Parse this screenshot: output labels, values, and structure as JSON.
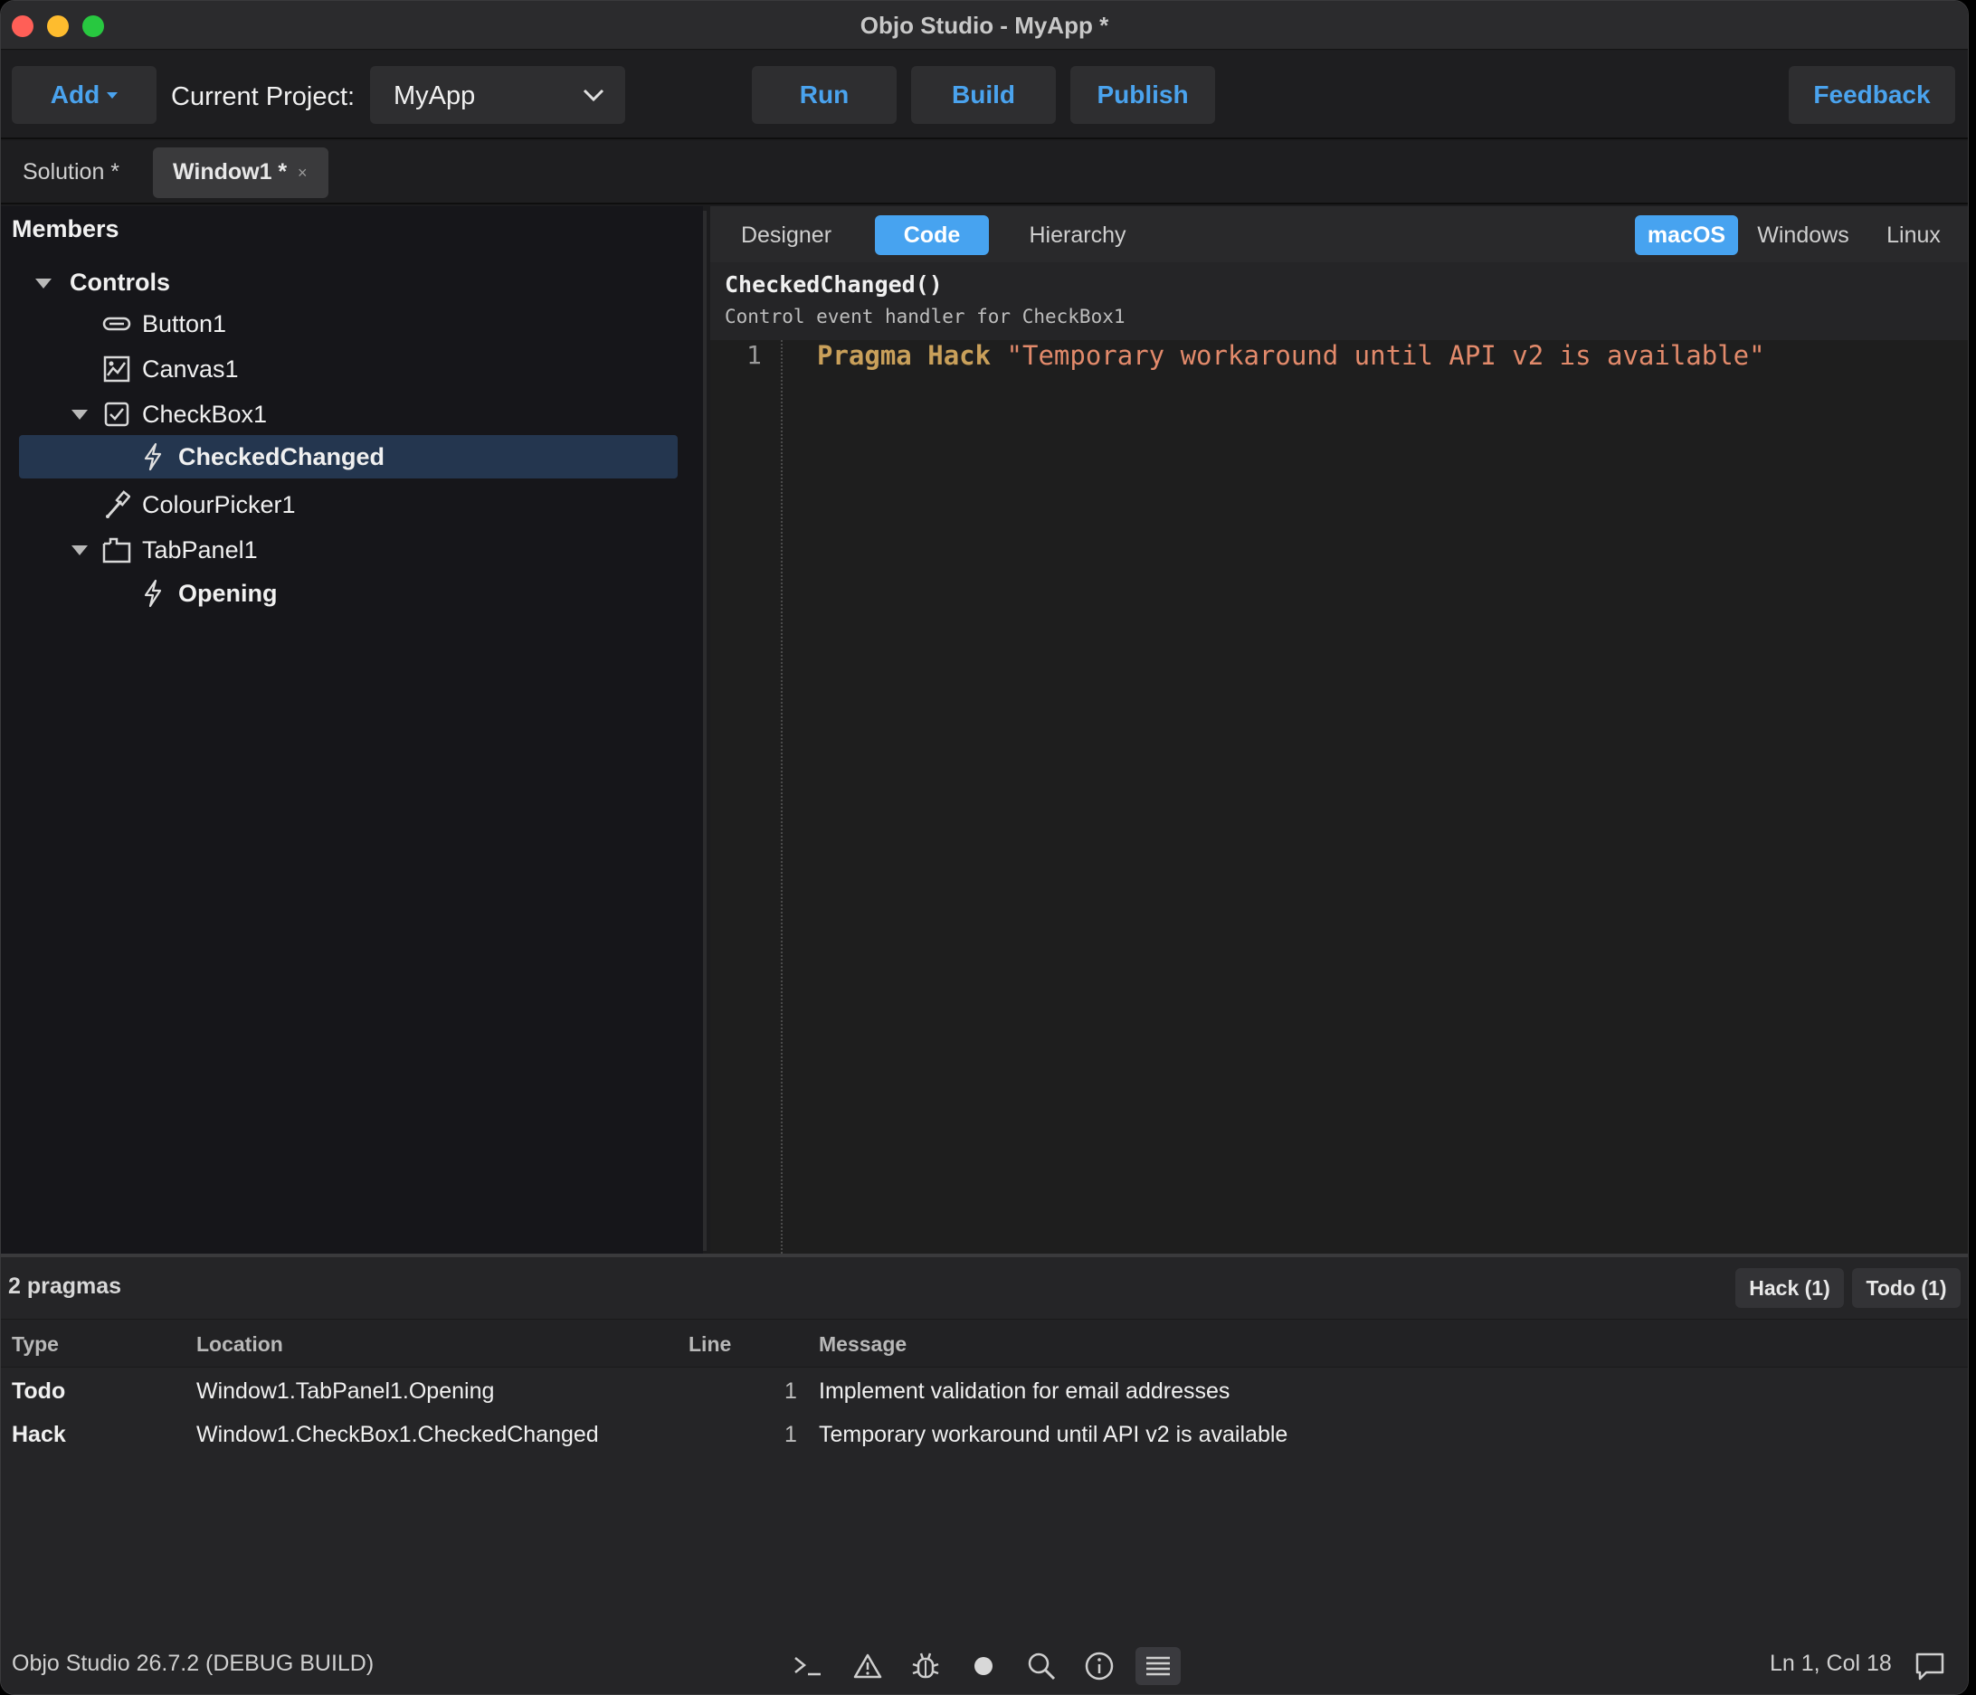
{
  "window": {
    "title": "Objo Studio - MyApp *"
  },
  "toolbar": {
    "add_label": "Add",
    "project_label": "Current Project:",
    "project_value": "MyApp",
    "run_label": "Run",
    "build_label": "Build",
    "publish_label": "Publish",
    "feedback_label": "Feedback",
    "accent_color": "#4aa3ee"
  },
  "doc_tabs": {
    "solution_label": "Solution *",
    "window1_label": "Window1 *",
    "close_glyph": "×"
  },
  "members": {
    "title": "Members",
    "controls_label": "Controls",
    "items": [
      {
        "label": "Button1",
        "icon": "button-icon"
      },
      {
        "label": "Canvas1",
        "icon": "canvas-icon"
      },
      {
        "label": "CheckBox1",
        "icon": "checkbox-icon"
      },
      {
        "label": "CheckedChanged",
        "icon": "event-bolt-icon",
        "selected": true
      },
      {
        "label": "ColourPicker1",
        "icon": "colour-picker-icon"
      },
      {
        "label": "TabPanel1",
        "icon": "tab-panel-icon"
      },
      {
        "label": "Opening",
        "icon": "event-bolt-icon"
      }
    ],
    "selected_color": "#24364f"
  },
  "view_tabs": {
    "designer": "Designer",
    "code": "Code",
    "hierarchy": "Hierarchy",
    "macos": "macOS",
    "windows": "Windows",
    "linux": "Linux",
    "active_color": "#47a3f0"
  },
  "editor": {
    "signature": "CheckedChanged()",
    "description": "Control event handler for CheckBox1",
    "line_number": "1",
    "keyword_pragma": "Pragma",
    "keyword_hack": "Hack",
    "string_value": "\"Temporary workaround until API v2 is available\""
  },
  "pragmas": {
    "count_label": "2 pragmas",
    "hack_filter": "Hack (1)",
    "todo_filter": "Todo (1)",
    "columns": {
      "type": "Type",
      "location": "Location",
      "line": "Line",
      "message": "Message"
    },
    "rows": [
      {
        "type": "Todo",
        "location": "Window1.TabPanel1.Opening",
        "line": "1",
        "message": "Implement validation for email addresses"
      },
      {
        "type": "Hack",
        "location": "Window1.CheckBox1.CheckedChanged",
        "line": "1",
        "message": "Temporary workaround until API v2 is available"
      }
    ]
  },
  "status": {
    "version_text": "Objo Studio 26.7.2 (DEBUG BUILD)",
    "cursor_position": "Ln 1, Col 18"
  }
}
